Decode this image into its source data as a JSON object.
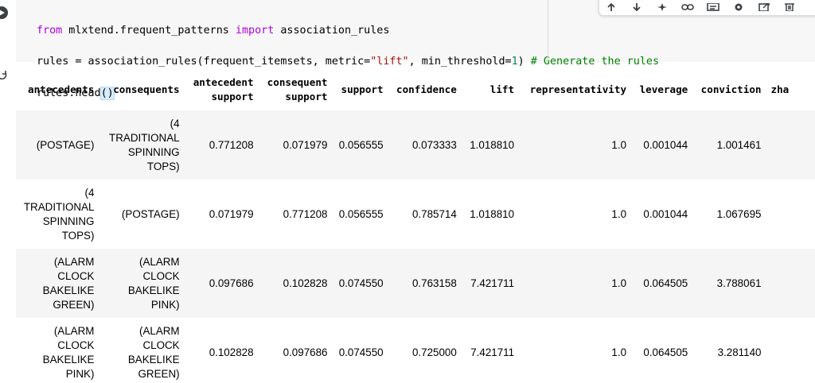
{
  "code": {
    "line1": {
      "kw1": "from",
      "mod": " mlxtend.frequent_patterns ",
      "kw2": "import",
      "name": " association_rules"
    },
    "line2": {
      "pre": "rules = association_rules(frequent_itemsets, metric=",
      "str": "\"lift\"",
      "mid": ", min_threshold=",
      "num": "1",
      "post": ") ",
      "comment": "# Generate the rules"
    },
    "line3": {
      "pre": "rules.head",
      "paren": "()"
    }
  },
  "toolbar": {
    "icons": [
      "arrow-up-icon",
      "arrow-down-icon",
      "sparkle-icon",
      "link-icon",
      "comment-icon",
      "gear-icon",
      "external-icon",
      "trash-icon"
    ]
  },
  "table": {
    "columns": [
      [
        "antecedents"
      ],
      [
        "consequents"
      ],
      [
        "antecedent",
        "support"
      ],
      [
        "consequent",
        "support"
      ],
      [
        "support"
      ],
      [
        "confidence"
      ],
      [
        "lift"
      ],
      [
        "representativity"
      ],
      [
        "leverage"
      ],
      [
        "conviction"
      ],
      [
        "zha"
      ]
    ],
    "rows": [
      [
        "(POSTAGE)",
        "(4 TRADITIONAL SPINNING TOPS)",
        "0.771208",
        "0.071979",
        "0.056555",
        "0.073333",
        "1.018810",
        "1.0",
        "0.001044",
        "1.001461",
        ""
      ],
      [
        "(4 TRADITIONAL SPINNING TOPS)",
        "(POSTAGE)",
        "0.071979",
        "0.771208",
        "0.056555",
        "0.785714",
        "1.018810",
        "1.0",
        "0.001044",
        "1.067695",
        ""
      ],
      [
        "(ALARM CLOCK BAKELIKE GREEN)",
        "(ALARM CLOCK BAKELIKE PINK)",
        "0.097686",
        "0.102828",
        "0.074550",
        "0.763158",
        "7.421711",
        "1.0",
        "0.064505",
        "3.788061",
        ""
      ],
      [
        "(ALARM CLOCK BAKELIKE PINK)",
        "(ALARM CLOCK BAKELIKE GREEN)",
        "0.102828",
        "0.097686",
        "0.074550",
        "0.725000",
        "7.421711",
        "1.0",
        "0.064505",
        "3.281140",
        ""
      ]
    ]
  }
}
